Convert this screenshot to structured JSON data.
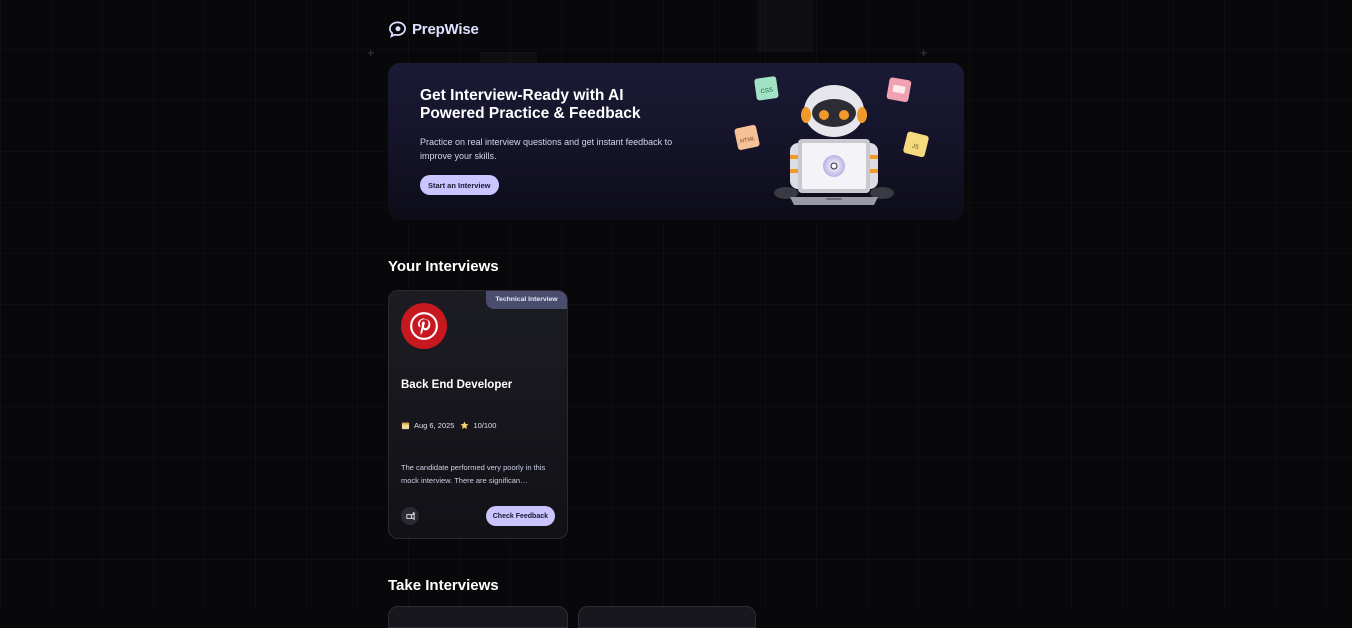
{
  "brand": {
    "name": "PrepWise"
  },
  "hero": {
    "title": "Get Interview-Ready with AI Powered Practice & Feedback",
    "subtitle": "Practice on real interview questions and get instant feedback to improve your skills.",
    "cta_label": "Start an Interview",
    "tech_tags": [
      "CSS",
      "HTML",
      "JS"
    ]
  },
  "your_interviews": {
    "heading": "Your Interviews",
    "cards": [
      {
        "type_badge": "Technical Interview",
        "role": "Back End Developer",
        "date": "Aug 6, 2025",
        "score": "10/100",
        "summary": "The candidate performed very poorly in this mock interview. There are significan…",
        "cta_label": "Check Feedback",
        "company_icon": "pinterest-logo"
      }
    ]
  },
  "take_interviews": {
    "heading": "Take Interviews"
  },
  "colors": {
    "accent": "#cac5fe",
    "brand_text": "#dde0ff",
    "badge_bg": "#4b4d6e",
    "company_red": "#c8181f"
  }
}
